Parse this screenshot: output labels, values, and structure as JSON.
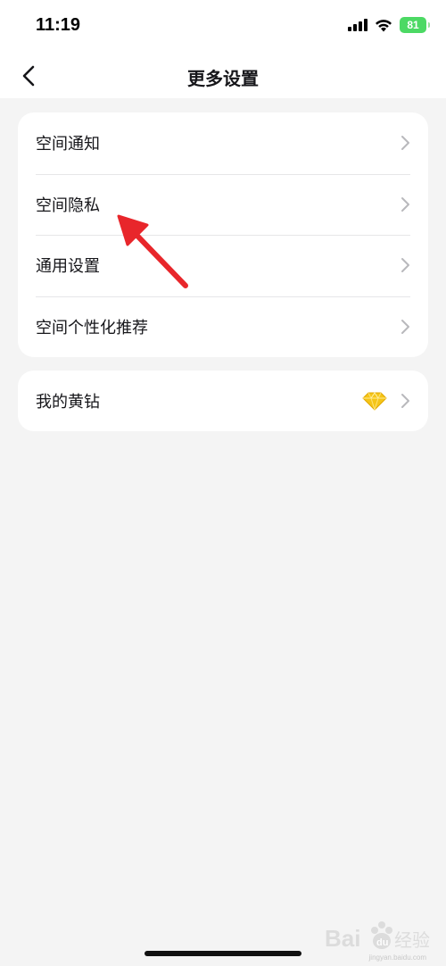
{
  "status_bar": {
    "time": "11:19",
    "battery": "81",
    "icons": [
      "cellular-signal-icon",
      "wifi-icon",
      "battery-icon"
    ]
  },
  "nav": {
    "title": "更多设置",
    "back_icon": "chevron-left-icon"
  },
  "settings": {
    "group1": [
      {
        "label": "空间通知"
      },
      {
        "label": "空间隐私"
      },
      {
        "label": "通用设置"
      },
      {
        "label": "空间个性化推荐"
      }
    ],
    "group2": [
      {
        "label": "我的黄钻",
        "icon": "yellow-diamond-icon"
      }
    ]
  },
  "annotation": {
    "color": "#e8262b",
    "target": "空间隐私"
  },
  "watermark": {
    "brand": "Baidu经验",
    "url": "jingyan.baidu.com"
  },
  "colors": {
    "background": "#f4f4f4",
    "card": "#ffffff",
    "text": "#16161a",
    "chevron": "#b8b8bc",
    "battery": "#4cd964",
    "diamond": "#f5c518"
  }
}
